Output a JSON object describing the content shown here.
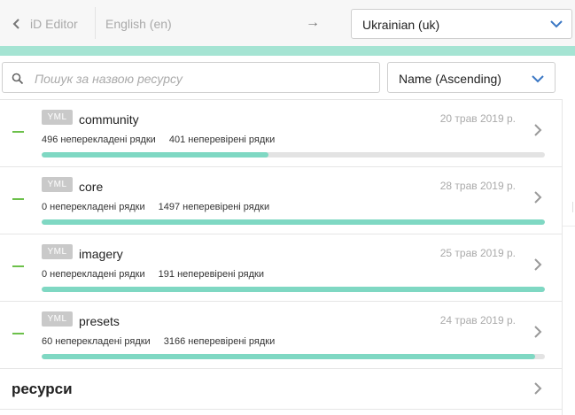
{
  "header": {
    "back_label": "iD Editor",
    "source_language": "English (en)",
    "arrow": "→",
    "target_language": "Ukrainian (uk)"
  },
  "filters": {
    "search_placeholder": "Пошук за назвою ресурсу",
    "search_value": "",
    "sort_value": "Name (Ascending)"
  },
  "resources": [
    {
      "format": "YML",
      "name": "community",
      "date": "20 трав 2019 р.",
      "untranslated": "496 неперекладені рядки",
      "unreviewed": "401 неперевірені рядки",
      "progress": 0.45
    },
    {
      "format": "YML",
      "name": "core",
      "date": "28 трав 2019 р.",
      "untranslated": "0 неперекладені рядки",
      "unreviewed": "1497 неперевірені рядки",
      "progress": 1.0
    },
    {
      "format": "YML",
      "name": "imagery",
      "date": "25 трав 2019 р.",
      "untranslated": "0 неперекладені рядки",
      "unreviewed": "191 неперевірені рядки",
      "progress": 1.0
    },
    {
      "format": "YML",
      "name": "presets",
      "date": "24 трав 2019 р.",
      "untranslated": "60 неперекладені рядки",
      "unreviewed": "3166 неперевірені рядки",
      "progress": 0.98
    }
  ],
  "group": {
    "label": "ресурси"
  },
  "colors": {
    "accent": "#a5e4d3",
    "progress": "#7fd8c3",
    "status_dash": "#6cc04a",
    "link_blue": "#3a77c4"
  }
}
